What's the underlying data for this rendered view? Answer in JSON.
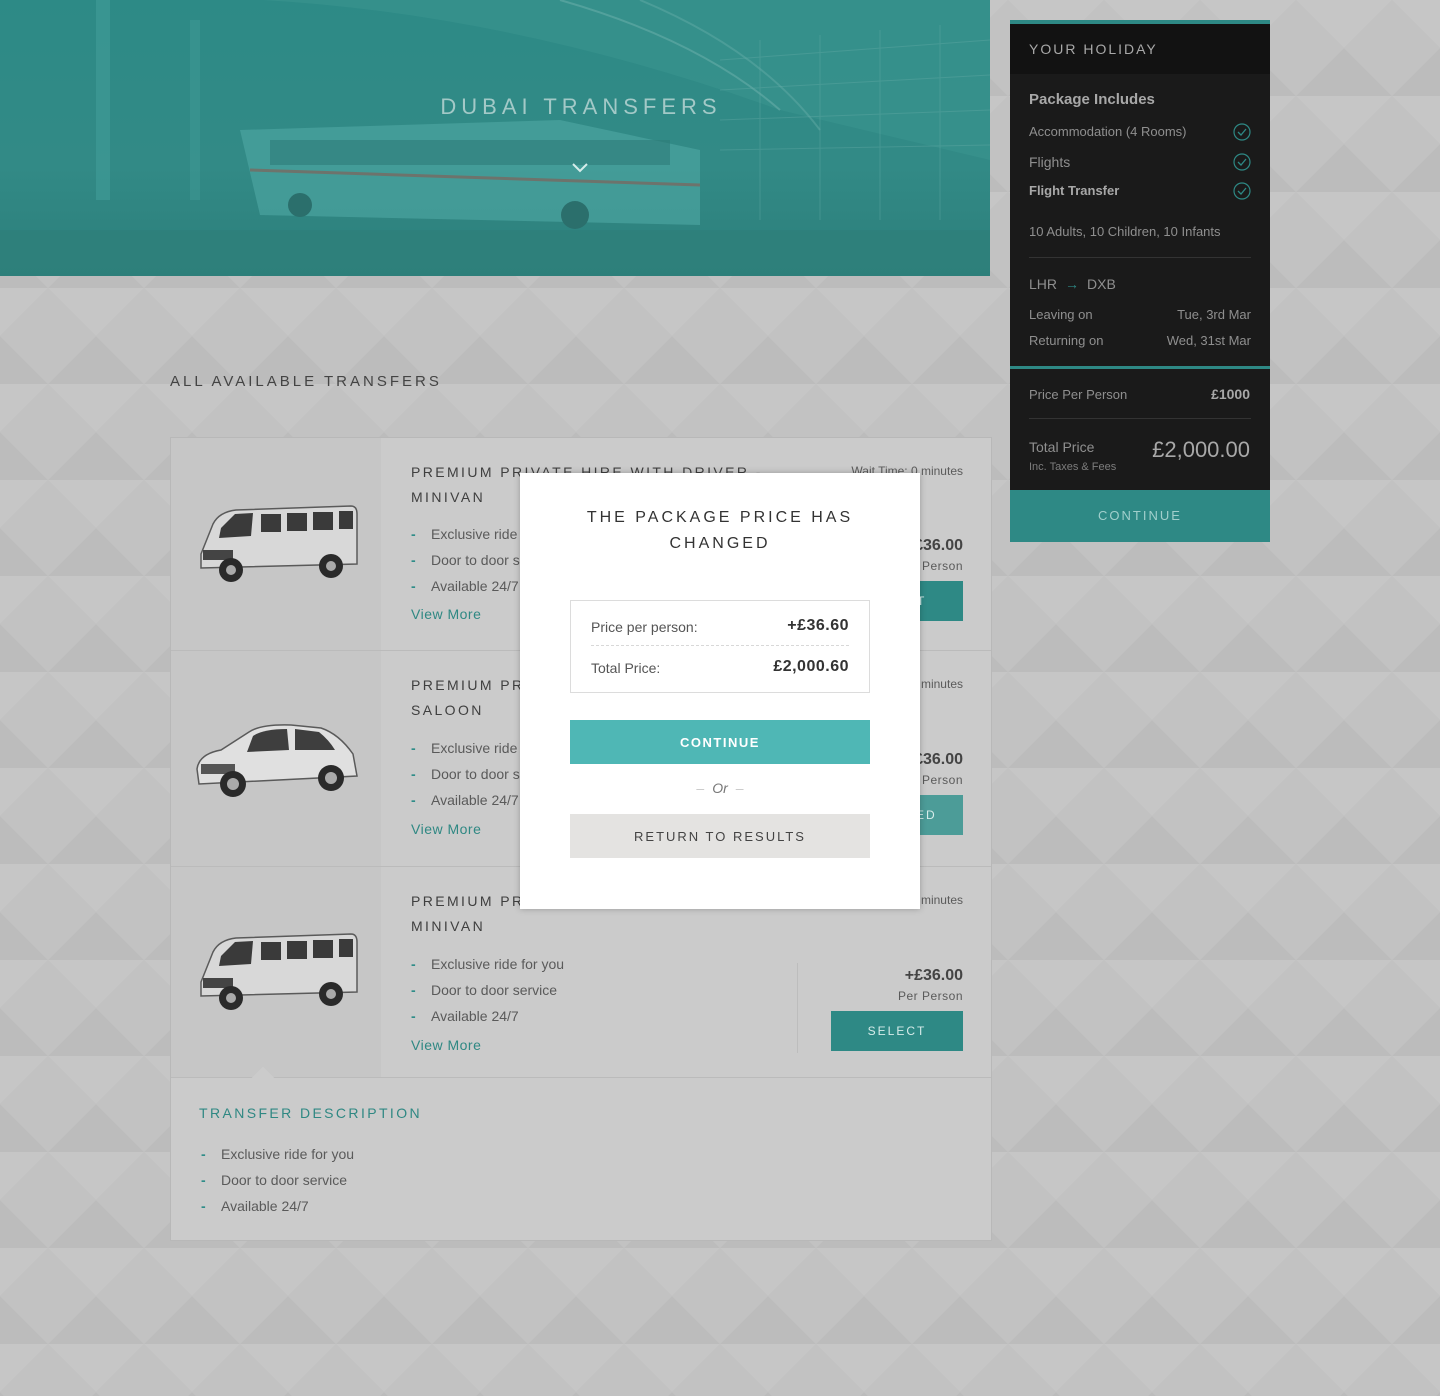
{
  "hero": {
    "title": "DUBAI TRANSFERS"
  },
  "section_title": "ALL AVAILABLE TRANSFERS",
  "transfers": [
    {
      "name": "PREMIUM PRIVATE HIRE WITH DRIVER - MINIVAN",
      "wait": "Wait Time: 0 minutes",
      "features": [
        "Exclusive ride for you",
        "Door to door service",
        "Available 24/7"
      ],
      "view_more": "View More",
      "price": "+£36.00",
      "per": "Per Person",
      "action": "SELECT",
      "vehicle_icon": "minivan-icon"
    },
    {
      "name": "PREMIUM PRIVATE HIRE WITH DRIVER - SALOON",
      "wait": "Wait Time: 0 minutes",
      "features": [
        "Exclusive ride for you",
        "Door to door service",
        "Available 24/7"
      ],
      "view_more": "View More",
      "price": "+£36.00",
      "per": "Per Person",
      "action": "SELECTED",
      "vehicle_icon": "saloon-car-icon"
    },
    {
      "name": "PREMIUM PRIVATE HIRE WITH DRIVER - MINIVAN",
      "wait": "Wait Time: 0 minutes",
      "features": [
        "Exclusive ride for you",
        "Door to door service",
        "Available 24/7"
      ],
      "view_more": "View More",
      "price": "+£36.00",
      "per": "Per Person",
      "action": "SELECT",
      "vehicle_icon": "minivan-icon"
    }
  ],
  "description": {
    "title": "TRANSFER DESCRIPTION",
    "items": [
      "Exclusive ride for you",
      "Door to door service",
      "Available 24/7"
    ]
  },
  "sidebar": {
    "title": "YOUR HOLIDAY",
    "package_title": "Package Includes",
    "includes": [
      "Accommodation (4 Rooms)",
      "Flights",
      "Flight Transfer"
    ],
    "pax": "10 Adults, 10 Children, 10 Infants",
    "from": "LHR",
    "to": "DXB",
    "leaving_label": "Leaving on",
    "leaving_value": "Tue, 3rd Mar",
    "returning_label": "Returning on",
    "returning_value": "Wed, 31st Mar",
    "ppp_label": "Price Per Person",
    "ppp_value": "£1000",
    "total_label": "Total Price",
    "total_sub": "Inc. Taxes & Fees",
    "total_value": "£2,000.00",
    "continue": "CONTINUE"
  },
  "modal": {
    "title_line1": "THE PACKAGE PRICE HAS",
    "title_line2": "CHANGED",
    "ppp_label": "Price per person:",
    "ppp_value": "+£36.60",
    "total_label": "Total Price:",
    "total_value": "£2,000.60",
    "continue": "CONTINUE",
    "or": "Or",
    "return": "RETURN TO RESULTS"
  },
  "colors": {
    "accent": "#4fb7b5",
    "accent_dim": "#2e8985",
    "sidebar_bg": "#1a1a1a",
    "overlay_bg": "#c2c2c2"
  }
}
